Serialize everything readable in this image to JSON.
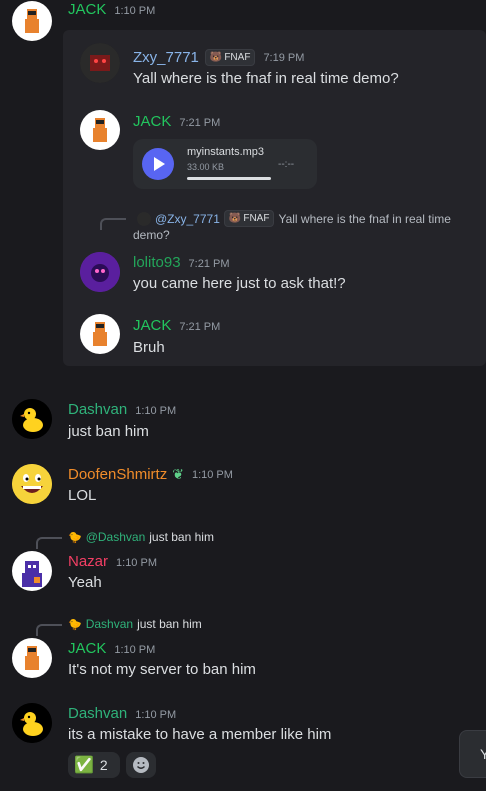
{
  "theme": {
    "jack": "#22c55e",
    "zxy": "#89b4e8",
    "lolito": "#23a55a",
    "dashvan": "#2fb27a",
    "doofen": "#f08c2a",
    "nazar": "#f23f64",
    "accent": "#5865f2"
  },
  "messages": {
    "jack_top": {
      "name": "JACK",
      "time": "1:10 PM"
    },
    "zxy": {
      "name": "Zxy_7771",
      "badge": "FNAF",
      "time": "7:19 PM",
      "text": "Yall where is the fnaf in real time demo?"
    },
    "jack_audio": {
      "name": "JACK",
      "time": "7:21 PM",
      "file": "myinstants.mp3",
      "size": "33.00 KB",
      "duration": "--:--"
    },
    "lolito_reply": {
      "mention": "@Zxy_7771",
      "badge": "FNAF",
      "text_line1": "Yall where is the fnaf in real time",
      "text_line2": "demo?"
    },
    "lolito": {
      "name": "lolito93",
      "time": "7:21 PM",
      "text": "you came here just to ask that!?"
    },
    "jack_bruh": {
      "name": "JACK",
      "time": "7:21 PM",
      "text": "Bruh"
    },
    "dashvan1": {
      "name": "Dashvan",
      "time": "1:10 PM",
      "text": "just ban him"
    },
    "doofen": {
      "name": "DoofenShmirtz",
      "time": "1:10 PM",
      "text": "LOL"
    },
    "nazar_reply": {
      "mention": "@Dashvan",
      "text": "just ban him"
    },
    "nazar": {
      "name": "Nazar",
      "time": "1:10 PM",
      "text": "Yeah"
    },
    "jack2_reply": {
      "mention": "Dashvan",
      "text": "just ban him"
    },
    "jack2": {
      "name": "JACK",
      "time": "1:10 PM",
      "text": "It's not my server to ban him"
    },
    "dashvan2": {
      "name": "Dashvan",
      "time": "1:10 PM",
      "text": "its a mistake to have a member like him"
    }
  },
  "reactions": {
    "check_emoji": "✅",
    "check_count": "2"
  },
  "corner_popup": {
    "text": "Y"
  }
}
